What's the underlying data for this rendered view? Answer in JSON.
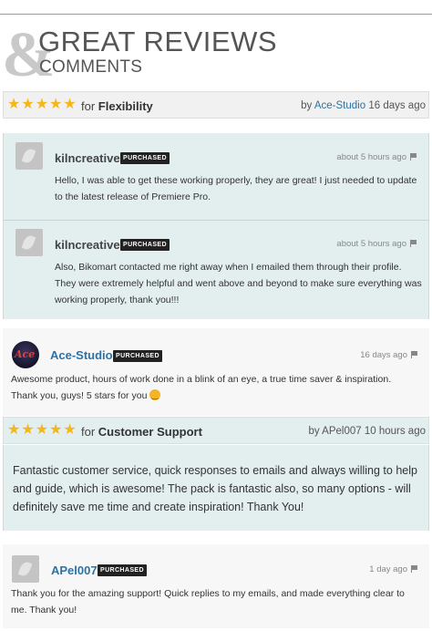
{
  "header": {
    "ampersand": "&",
    "title_big": "GREAT REVIEWS",
    "title_small": "COMMENTS"
  },
  "colors": {
    "star": "#f3b61b",
    "link": "#2a73a8",
    "teal_bg": "#e3eeee",
    "badge": "#222222"
  },
  "reviews": [
    {
      "stars": "★★★★★",
      "for_prefix": "for",
      "category": "Flexibility",
      "by_prefix": "by",
      "author": "Ace-Studio",
      "time": "16 days ago",
      "comments": [
        {
          "avatar_icon": "envato-leaf-icon",
          "author": "kilncreative",
          "badge": "PURCHASED",
          "time": "about 5 hours ago",
          "flag_icon": "flag-icon",
          "text": "Hello, I was able to get these working properly, they are great! I just needed to update to the latest release of Premiere Pro."
        },
        {
          "avatar_icon": "envato-leaf-icon",
          "author": "kilncreative",
          "badge": "PURCHASED",
          "time": "about 5 hours ago",
          "flag_icon": "flag-icon",
          "text": "Also, Bikomart contacted me right away when I emailed them through their profile. They were extremely helpful and went above and beyond to make sure everything was working properly, thank you!!!"
        },
        {
          "avatar_icon": "ace-studio-logo",
          "author": "Ace-Studio",
          "badge": "PURCHASED",
          "time": "16 days ago",
          "flag_icon": "flag-icon",
          "text_line1": "Awesome product, hours of work done in a blink of an eye, a true time saver & inspiration.",
          "text_line2": "Thank you, guys! 5 stars for you",
          "emoji_icon": "smiley-icon"
        }
      ]
    },
    {
      "stars": "★★★★★",
      "for_prefix": "for",
      "category": "Customer Support",
      "by_prefix": "by",
      "author": "APel007",
      "time": "10 hours ago",
      "body": "Fantastic customer service, quick responses to emails and always willing to help and guide, which is awesome! The pack is fantastic also, so many options - will definitely save me time and create inspiration! Thank You!",
      "comments": [
        {
          "avatar_icon": "envato-leaf-icon",
          "author": "APel007",
          "badge": "PURCHASED",
          "time": "1 day ago",
          "flag_icon": "flag-icon",
          "text": "Thank you for the amazing support! Quick replies to my emails, and made everything clear to me. Thank you!"
        }
      ]
    }
  ]
}
